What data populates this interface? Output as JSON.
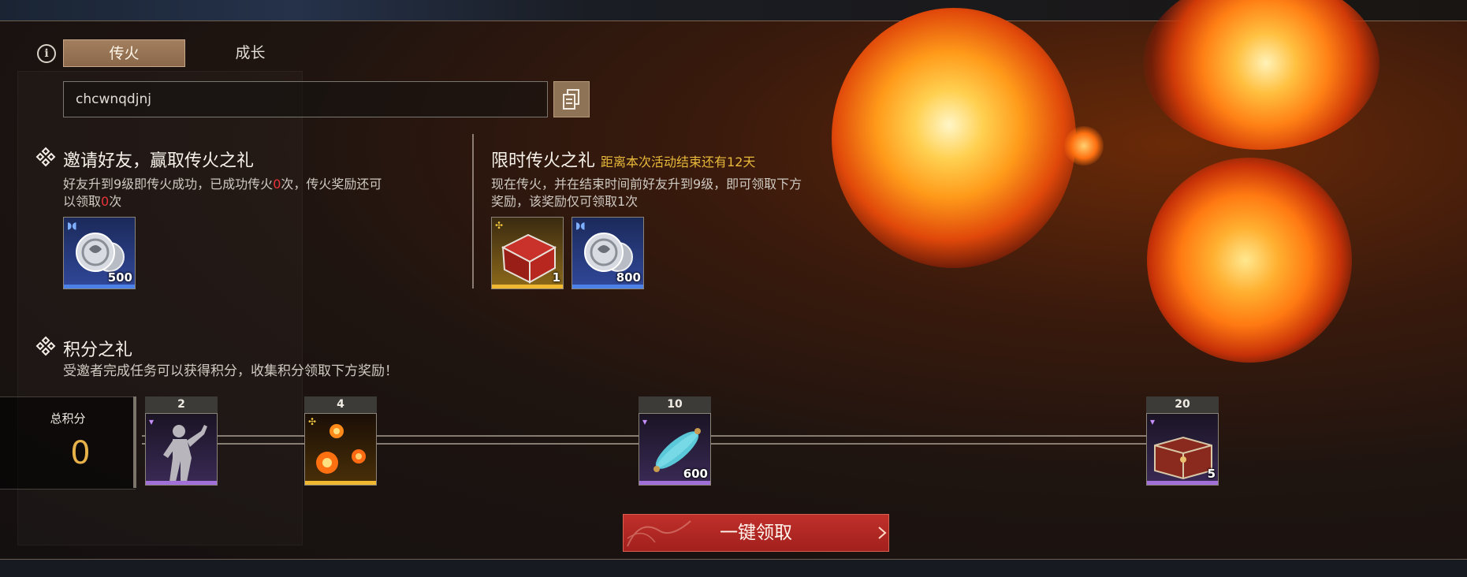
{
  "tabs": [
    {
      "label": "传火",
      "active": true
    },
    {
      "label": "成长",
      "active": false
    }
  ],
  "invite_code": "chcwnqdjnj",
  "invite_section": {
    "title": "邀请好友，赢取传火之礼",
    "desc_part1": "好友升到9级即传火成功，已成功传火",
    "success_count": "0",
    "desc_part2": "次，传火奖励还可",
    "desc_part3": "以领取",
    "remaining_count": "0",
    "desc_part4": "次",
    "rewards": [
      {
        "icon": "silver-coins-icon",
        "qty": "500",
        "rarity": "blue"
      }
    ]
  },
  "limited_section": {
    "title": "限时传火之礼",
    "countdown": "距离本次活动结束还有12天",
    "desc_line1": "现在传火，并在结束时间前好友升到9级，即可领取下方",
    "desc_line2": "奖励，该奖励仅可领取1次",
    "rewards": [
      {
        "icon": "red-chest-icon",
        "qty": "1",
        "rarity": "gold"
      },
      {
        "icon": "silver-coins-icon",
        "qty": "800",
        "rarity": "blue"
      }
    ]
  },
  "points_section": {
    "title": "积分之礼",
    "desc": "受邀者完成任务可以获得积分，收集积分领取下方奖励！",
    "total_label": "总积分",
    "total_value": "0",
    "milestones": [
      {
        "points": "2",
        "icon": "dance-pose-icon",
        "qty": "",
        "rarity": "purple"
      },
      {
        "points": "4",
        "icon": "fire-sparks-icon",
        "qty": "",
        "rarity": "gold"
      },
      {
        "points": "10",
        "icon": "blue-scroll-icon",
        "qty": "600",
        "rarity": "purple"
      },
      {
        "points": "20",
        "icon": "ornate-chest-icon",
        "qty": "5",
        "rarity": "purple"
      }
    ]
  },
  "claim_button": "一键领取",
  "colors": {
    "accent_gold": "#e8b93a",
    "accent_red": "#e8343a",
    "tab_active": "#a27e5e",
    "button_red": "#b0281f"
  }
}
